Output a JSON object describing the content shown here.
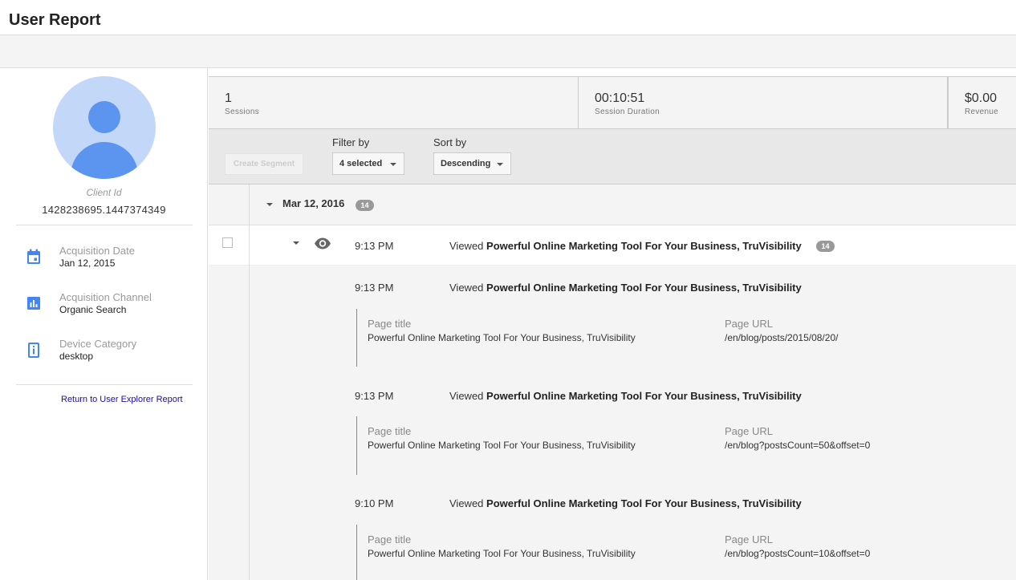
{
  "page": {
    "title": "User Report"
  },
  "user": {
    "client_id_label": "Client Id",
    "client_id": "1428238695.1447374349",
    "meta": [
      {
        "label": "Acquisition Date",
        "value": "Jan 12, 2015",
        "icon": "calendar-icon"
      },
      {
        "label": "Acquisition Channel",
        "value": "Organic Search",
        "icon": "bar-chart-icon"
      },
      {
        "label": "Device Category",
        "value": "desktop",
        "icon": "device-icon"
      }
    ],
    "return_link": "Return to User Explorer Report"
  },
  "stats": [
    {
      "value": "1",
      "label": "Sessions"
    },
    {
      "value": "00:10:51",
      "label": "Session Duration"
    },
    {
      "value": "$0.00",
      "label": "Revenue"
    }
  ],
  "controls": {
    "create_segment": "Create Segment",
    "filter_label": "Filter by",
    "filter_value": "4 selected",
    "sort_label": "Sort by",
    "sort_value": "Descending"
  },
  "date_group": {
    "date": "Mar 12, 2016",
    "count": "14"
  },
  "session": {
    "time": "9:13 PM",
    "prefix": "Viewed",
    "title": "Powerful Online Marketing Tool For Your Business, TruVisibility",
    "count": "14"
  },
  "hits": [
    {
      "time": "9:13 PM",
      "prefix": "Viewed",
      "title": "Powerful Online Marketing Tool For Your Business, TruVisibility",
      "page_title_label": "Page title",
      "page_title": "Powerful Online Marketing Tool For Your Business, TruVisibility",
      "page_url_label": "Page URL",
      "page_url": "/en/blog/posts/2015/08/20/"
    },
    {
      "time": "9:13 PM",
      "prefix": "Viewed",
      "title": "Powerful Online Marketing Tool For Your Business, TruVisibility",
      "page_title_label": "Page title",
      "page_title": "Powerful Online Marketing Tool For Your Business, TruVisibility",
      "page_url_label": "Page URL",
      "page_url": "/en/blog?postsCount=50&offset=0"
    },
    {
      "time": "9:10 PM",
      "prefix": "Viewed",
      "title": "Powerful Online Marketing Tool For Your Business, TruVisibility",
      "page_title_label": "Page title",
      "page_title": "Powerful Online Marketing Tool For Your Business, TruVisibility",
      "page_url_label": "Page URL",
      "page_url": "/en/blog?postsCount=10&offset=0"
    }
  ],
  "colors": {
    "accent": "#4285f4",
    "avatar_bg": "#c3d7f9",
    "avatar_fg": "#5b95f0",
    "link": "#1a0dab",
    "badge": "#999999"
  }
}
